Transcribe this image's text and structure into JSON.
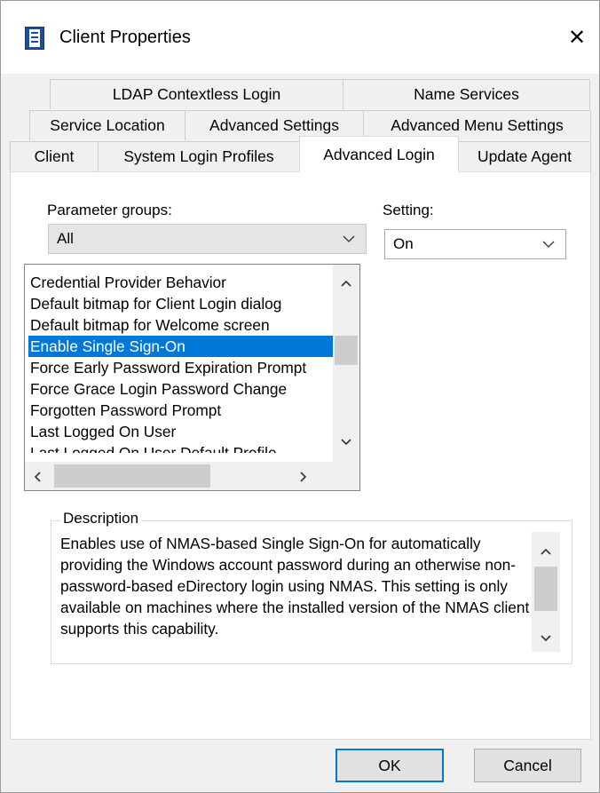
{
  "window": {
    "title": "Client Properties",
    "close_glyph": "✕",
    "icon": "properties-document-icon"
  },
  "tabs": {
    "row1": [
      "LDAP Contextless Login",
      "Name Services"
    ],
    "row2": [
      "Service Location",
      "Advanced Settings",
      "Advanced Menu Settings"
    ],
    "row3": [
      "Client",
      "System Login Profiles",
      "Advanced Login",
      "Update Agent"
    ],
    "active": "Advanced Login"
  },
  "parameter_groups": {
    "label": "Parameter groups:",
    "selected": "All"
  },
  "setting": {
    "label": "Setting:",
    "selected": "On"
  },
  "parameters": {
    "items": [
      "Credential Provider Behavior",
      "Default bitmap for Client Login dialog",
      "Default bitmap for Welcome screen",
      "Enable Single Sign-On",
      "Force Early Password Expiration Prompt",
      "Force Grace Login Password Change",
      "Forgotten Password Prompt",
      "Last Logged On User",
      "Last Logged On User Default Profile"
    ],
    "selected_index": 3
  },
  "description": {
    "legend": "Description",
    "text": "Enables use of NMAS-based Single Sign-On for automatically providing the Windows account password during an otherwise non-password-based eDirectory login using NMAS.  This setting is only available on machines where the installed version of the NMAS client supports this capability."
  },
  "buttons": {
    "ok": "OK",
    "cancel": "Cancel"
  },
  "colors": {
    "selection": "#0078d7",
    "default_button_border": "#0078d7"
  }
}
